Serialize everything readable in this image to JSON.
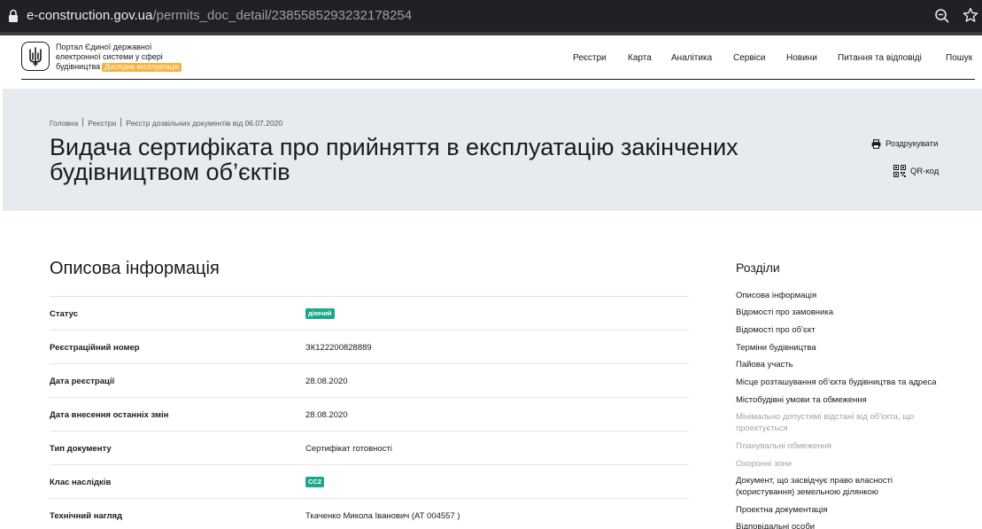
{
  "browser": {
    "url_host": "e-construction.gov.ua",
    "url_path": "/permits_doc_detail/2385585293232178254"
  },
  "header": {
    "brand_line1": "Портал Єдиної державної",
    "brand_line2": "електронної системи у сфері",
    "brand_line3": "будівництва",
    "badge": "Дослідна експлуатація",
    "nav": [
      "Реєстри",
      "Карта",
      "Аналітика",
      "Сервіси",
      "Новини",
      "Питання та відповіді",
      "Пошук"
    ]
  },
  "hero": {
    "breadcrumbs": [
      "Головна",
      "Реєстри",
      "Реєстр дозвільних документів від 06.07.2020"
    ],
    "title_line1": "Видача сертифіката про прийняття в експлуатацію закінчених",
    "title_line2": "будівництвом об’єктів",
    "print_label": "Роздрукувати",
    "qr_label": "QR-код"
  },
  "main": {
    "section_title": "Описова інформація",
    "rows": [
      {
        "label": "Статус",
        "value": "діючий",
        "pill": true
      },
      {
        "label": "Реєстраційний номер",
        "value": "ЗК122200828889"
      },
      {
        "label": "Дата реєстрації",
        "value": "28.08.2020"
      },
      {
        "label": "Дата внесення останніх змін",
        "value": "28.08.2020"
      },
      {
        "label": "Тип документу",
        "value": "Сертифікат готовності"
      },
      {
        "label": "Клас наслідків",
        "value": "СС2",
        "pill": true
      },
      {
        "label": "Технічний нагляд",
        "value": "Ткаченко Микола Іванович (АТ 004557 )"
      }
    ]
  },
  "sidebar": {
    "title": "Розділи",
    "items": [
      {
        "line1": "Описова інформація",
        "line2": "",
        "muted": false
      },
      {
        "line1": "Відомості про замовника",
        "line2": "",
        "muted": false
      },
      {
        "line1": "Відомості про об’єкт",
        "line2": "",
        "muted": false
      },
      {
        "line1": "Терміни будівництва",
        "line2": "",
        "muted": false
      },
      {
        "line1": "Пайова участь",
        "line2": "",
        "muted": false
      },
      {
        "line1": "Місце розташування об’єкта будівництва та адреса",
        "line2": "",
        "muted": false
      },
      {
        "line1": "Містобудівні умови та обмеження",
        "line2": "",
        "muted": false
      },
      {
        "line1": "Мінімально допустимі відстані від об’єкта, що",
        "line2": "проектується",
        "muted": true
      },
      {
        "line1": "Планувальні обмеження",
        "line2": "",
        "muted": true
      },
      {
        "line1": "Охоронні зони",
        "line2": "",
        "muted": true
      },
      {
        "line1": "Документ, що засвідчує право власності",
        "line2": "(користування) земельною ділянкою",
        "muted": false
      },
      {
        "line1": "Проектна документація",
        "line2": "",
        "muted": false
      },
      {
        "line1": "Відповідальні особи",
        "line2": "",
        "muted": false
      }
    ]
  },
  "colors": {
    "accent_badge": "#f5b240",
    "status_pill": "#1aa88c",
    "hero_bg": "#e6ebf0",
    "muted_text": "#a0a4a8"
  },
  "icons": [
    "lock-icon",
    "zoom-icon",
    "star-icon",
    "trident-icon",
    "printer-icon",
    "qr-code-icon"
  ]
}
